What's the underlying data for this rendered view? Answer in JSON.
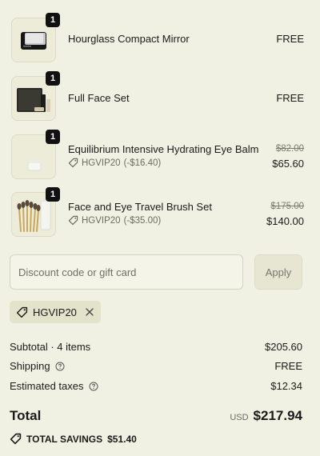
{
  "items": [
    {
      "name": "Hourglass Compact Mirror",
      "quantity": "1",
      "price": "FREE",
      "original_price": "",
      "code": "",
      "code_discount": "",
      "icon": "compact-mirror-thumbnail"
    },
    {
      "name": "Full Face Set",
      "quantity": "1",
      "price": "FREE",
      "original_price": "",
      "code": "",
      "code_discount": "",
      "icon": "makeup-set-thumbnail"
    },
    {
      "name": "Equilibrium Intensive Hydrating Eye Balm",
      "quantity": "1",
      "price": "$65.60",
      "original_price": "$82.00",
      "code": "HGVIP20",
      "code_discount": "(-$16.40)",
      "icon": "eye-balm-thumbnail"
    },
    {
      "name": "Face and Eye Travel Brush Set",
      "quantity": "1",
      "price": "$140.00",
      "original_price": "$175.00",
      "code": "HGVIP20",
      "code_discount": "(-$35.00)",
      "icon": "brush-set-thumbnail"
    }
  ],
  "discount": {
    "placeholder": "Discount code or gift card",
    "apply_label": "Apply",
    "applied_code": "HGVIP20"
  },
  "summary": {
    "subtotal_label": "Subtotal · 4 items",
    "subtotal_value": "$205.60",
    "shipping_label": "Shipping",
    "shipping_value": "FREE",
    "taxes_label": "Estimated taxes",
    "taxes_value": "$12.34",
    "total_label": "Total",
    "currency": "USD",
    "total_value": "$217.94",
    "savings_label": "TOTAL SAVINGS",
    "savings_value": "$51.40"
  },
  "colors": {
    "background": "#f1f1e3",
    "badge": "#111111",
    "muted_text": "#6b6b60",
    "chip_bg": "#e3e3cc"
  }
}
